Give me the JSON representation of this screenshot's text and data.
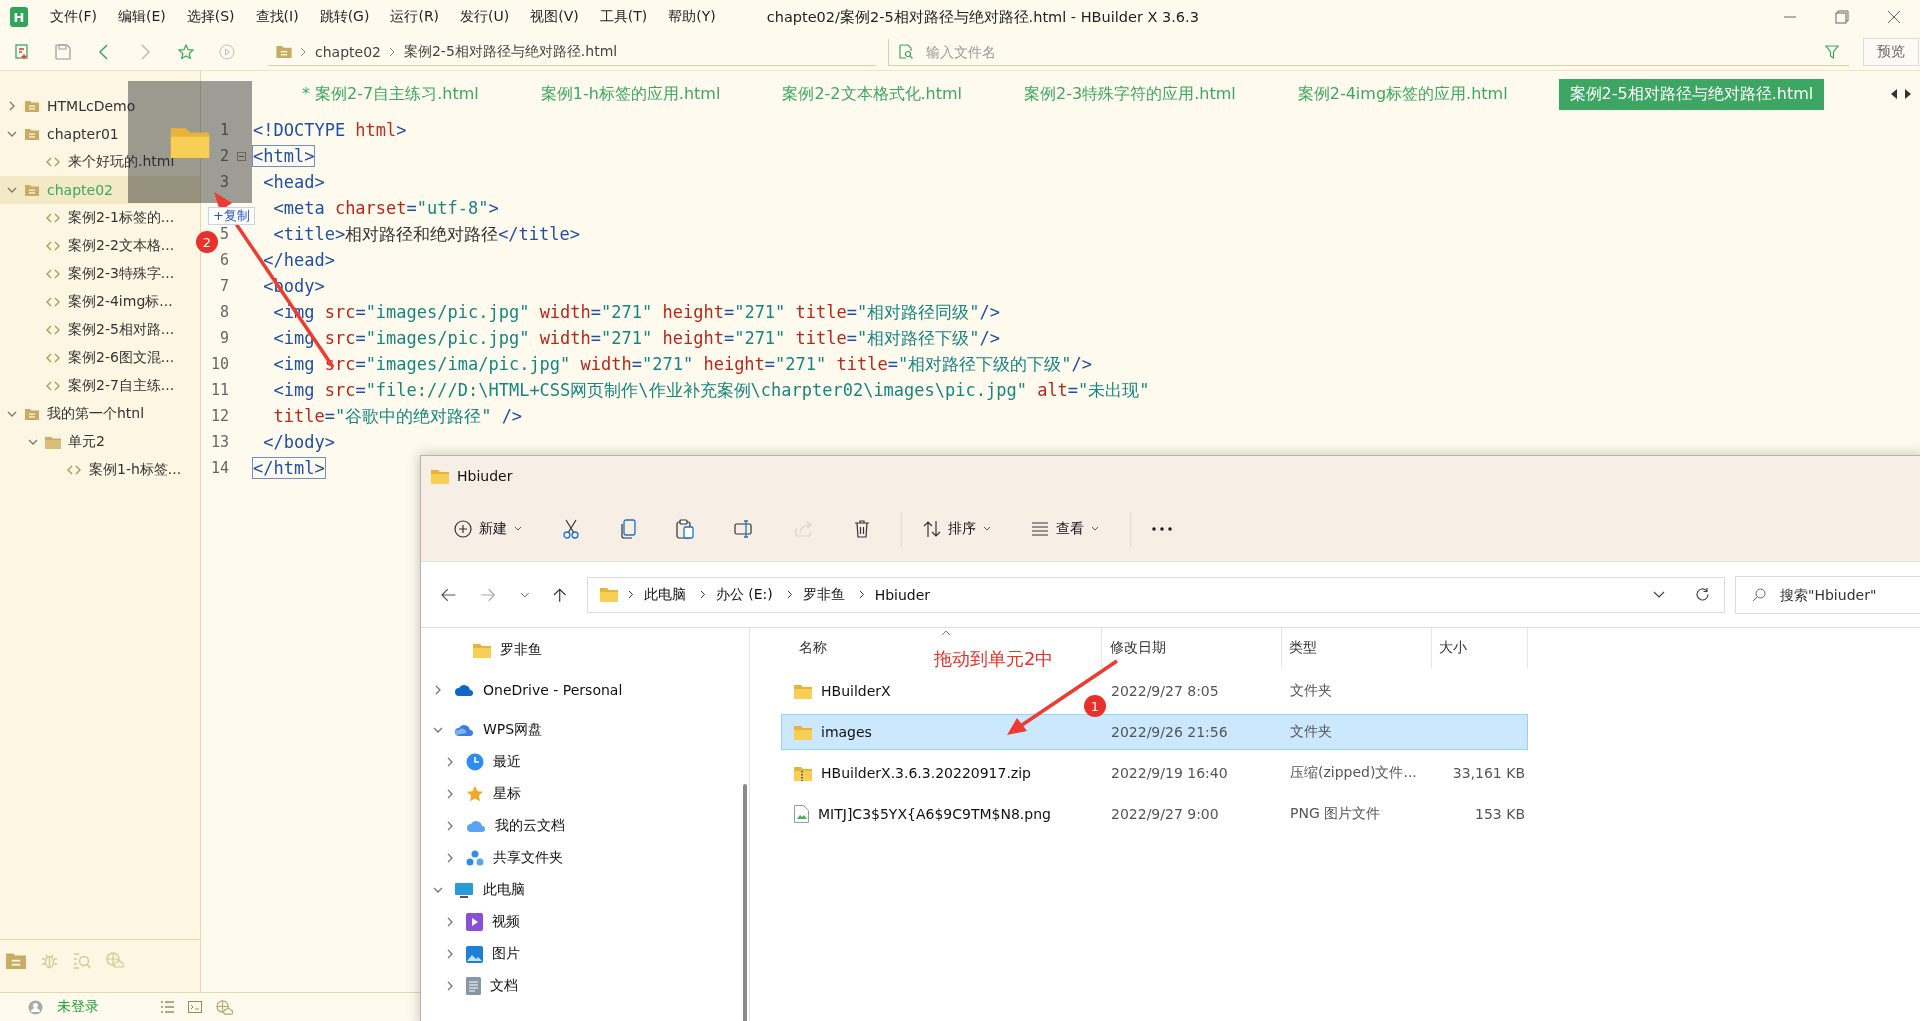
{
  "title_bar": {
    "logo": "H",
    "menus": [
      "文件(F)",
      "编辑(E)",
      "选择(S)",
      "查找(I)",
      "跳转(G)",
      "运行(R)",
      "发行(U)",
      "视图(V)",
      "工具(T)",
      "帮助(Y)"
    ],
    "title": "chapte02/案例2-5相对路径与绝对路径.html - HBuilder X 3.6.3"
  },
  "toolbar": {
    "breadcrumb": [
      "chapte02",
      "案例2-5相对路径与绝对路径.html"
    ],
    "search": {
      "placeholder": "输入文件名"
    },
    "preview_button": "预览"
  },
  "tabs": [
    {
      "label": "* 案例2-7自主练习.html",
      "selected": false
    },
    {
      "label": "案例1-h标签的应用.html",
      "selected": false
    },
    {
      "label": "案例2-2文本格式化.html",
      "selected": false
    },
    {
      "label": "案例2-3特殊字符的应用.html",
      "selected": false
    },
    {
      "label": "案例2-4img标签的应用.html",
      "selected": false
    },
    {
      "label": "案例2-5相对路径与绝对路径.html",
      "selected": true
    }
  ],
  "project_tree": [
    {
      "label": "HTMLcDemo",
      "kind": "project",
      "expanded": false,
      "selected": false
    },
    {
      "label": "chapter01",
      "kind": "project",
      "expanded": true,
      "selected": false,
      "children": [
        {
          "label": "来个好玩的.html",
          "kind": "file",
          "selected": false
        }
      ]
    },
    {
      "label": "chapte02",
      "kind": "project",
      "expanded": true,
      "selected": true,
      "children": [
        {
          "label": "案例2-1标签的...",
          "kind": "file",
          "selected": false
        },
        {
          "label": "案例2-2文本格...",
          "kind": "file",
          "selected": false
        },
        {
          "label": "案例2-3特殊字...",
          "kind": "file",
          "selected": false
        },
        {
          "label": "案例2-4img标...",
          "kind": "file",
          "selected": false
        },
        {
          "label": "案例2-5相对路...",
          "kind": "file",
          "selected": false
        },
        {
          "label": "案例2-6图文混...",
          "kind": "file",
          "selected": false
        },
        {
          "label": "案例2-7自主练...",
          "kind": "file",
          "selected": false
        }
      ]
    },
    {
      "label": "我的第一个htnl",
      "kind": "project",
      "expanded": true,
      "selected": false,
      "children": [
        {
          "label": "单元2",
          "kind": "folder",
          "expanded": true,
          "selected": false,
          "children": [
            {
              "label": "案例1-h标签...",
              "kind": "file",
              "selected": false
            }
          ]
        }
      ]
    }
  ],
  "editor": {
    "lines": [
      {
        "num": "1",
        "fold": false,
        "tokens": [
          {
            "kind": "tag",
            "text": "<!DOCTYPE "
          },
          {
            "kind": "kw",
            "text": "html"
          },
          {
            "kind": "tag",
            "text": ">"
          }
        ]
      },
      {
        "num": "2",
        "fold": true,
        "tokens": [
          {
            "kind": "match",
            "text": "<html>"
          }
        ]
      },
      {
        "num": "3",
        "fold": false,
        "tokens": [
          {
            "kind": "tag",
            "text": " <head>"
          }
        ]
      },
      {
        "fold": false,
        "tokens": [
          {
            "kind": "tag",
            "text": "  <meta "
          },
          {
            "kind": "attr",
            "text": "charset"
          },
          {
            "kind": "tag",
            "text": "="
          },
          {
            "kind": "str",
            "text": "\"utf-8\""
          },
          {
            "kind": "tag",
            "text": ">"
          }
        ]
      },
      {
        "num": "5",
        "fold": false,
        "tokens": [
          {
            "kind": "tag",
            "text": "  <title>"
          },
          {
            "kind": "text",
            "text": "相对路径和绝对路径"
          },
          {
            "kind": "tag",
            "text": "</title>"
          }
        ]
      },
      {
        "num": "6",
        "fold": false,
        "tokens": [
          {
            "kind": "tag",
            "text": " </head>"
          }
        ]
      },
      {
        "num": "7",
        "fold": false,
        "tokens": [
          {
            "kind": "tag",
            "text": " <body>"
          }
        ]
      },
      {
        "num": "8",
        "fold": false,
        "tokens": [
          {
            "kind": "tag",
            "text": "  <img "
          },
          {
            "kind": "attr",
            "text": "src"
          },
          {
            "kind": "tag",
            "text": "="
          },
          {
            "kind": "str",
            "text": "\"images/pic.jpg\""
          },
          {
            "kind": "attr",
            "text": " width"
          },
          {
            "kind": "tag",
            "text": "="
          },
          {
            "kind": "str",
            "text": "\"271\""
          },
          {
            "kind": "attr",
            "text": " height"
          },
          {
            "kind": "tag",
            "text": "="
          },
          {
            "kind": "str",
            "text": "\"271\""
          },
          {
            "kind": "attr",
            "text": " title"
          },
          {
            "kind": "tag",
            "text": "="
          },
          {
            "kind": "str",
            "text": "\"相对路径同级\""
          },
          {
            "kind": "tag",
            "text": "/>"
          }
        ]
      },
      {
        "num": "9",
        "fold": false,
        "tokens": [
          {
            "kind": "tag",
            "text": "  <img "
          },
          {
            "kind": "attr",
            "text": "src"
          },
          {
            "kind": "tag",
            "text": "="
          },
          {
            "kind": "str",
            "text": "\"images/pic.jpg\""
          },
          {
            "kind": "attr",
            "text": " width"
          },
          {
            "kind": "tag",
            "text": "="
          },
          {
            "kind": "str",
            "text": "\"271\""
          },
          {
            "kind": "attr",
            "text": " height"
          },
          {
            "kind": "tag",
            "text": "="
          },
          {
            "kind": "str",
            "text": "\"271\""
          },
          {
            "kind": "attr",
            "text": " title"
          },
          {
            "kind": "tag",
            "text": "="
          },
          {
            "kind": "str",
            "text": "\"相对路径下级\""
          },
          {
            "kind": "tag",
            "text": "/>"
          }
        ]
      },
      {
        "num": "10",
        "fold": false,
        "tokens": [
          {
            "kind": "tag",
            "text": "  <img "
          },
          {
            "kind": "attr",
            "text": "src"
          },
          {
            "kind": "tag",
            "text": "="
          },
          {
            "kind": "str",
            "text": "\"images/ima/pic.jpg\""
          },
          {
            "kind": "attr",
            "text": " width"
          },
          {
            "kind": "tag",
            "text": "="
          },
          {
            "kind": "str",
            "text": "\"271\""
          },
          {
            "kind": "attr",
            "text": " height"
          },
          {
            "kind": "tag",
            "text": "="
          },
          {
            "kind": "str",
            "text": "\"271\""
          },
          {
            "kind": "attr",
            "text": " title"
          },
          {
            "kind": "tag",
            "text": "="
          },
          {
            "kind": "str",
            "text": "\"相对路径下级的下级\""
          },
          {
            "kind": "tag",
            "text": "/>"
          }
        ]
      },
      {
        "num": "11",
        "fold": false,
        "tokens": [
          {
            "kind": "tag",
            "text": "  <img "
          },
          {
            "kind": "attr",
            "text": "src"
          },
          {
            "kind": "tag",
            "text": "="
          },
          {
            "kind": "str",
            "text": "\"file:///D:\\HTML+CSS网页制作\\作业补充案例\\charpter02\\images\\pic.jpg\""
          },
          {
            "kind": "attr",
            "text": " alt"
          },
          {
            "kind": "tag",
            "text": "="
          },
          {
            "kind": "str",
            "text": "\"未出现\""
          }
        ]
      },
      {
        "num": "12",
        "fold": false,
        "tokens": [
          {
            "kind": "attr",
            "text": "  title"
          },
          {
            "kind": "tag",
            "text": "="
          },
          {
            "kind": "str",
            "text": "\"谷歌中的绝对路径\""
          },
          {
            "kind": "tag",
            "text": " />"
          }
        ]
      },
      {
        "num": "13",
        "fold": false,
        "tokens": [
          {
            "kind": "tag",
            "text": " </body>"
          }
        ]
      },
      {
        "num": "14",
        "fold": false,
        "tokens": [
          {
            "kind": "match",
            "text": "</html>"
          }
        ]
      }
    ]
  },
  "drag": {
    "badge": "+复制"
  },
  "status_bar": {
    "user": "未登录"
  },
  "explorer": {
    "title": "Hbiuder",
    "commands": [
      {
        "kind": "new",
        "label": "新建",
        "dropdown": true,
        "disabled": false
      },
      {
        "kind": "cut",
        "dropdown": false,
        "disabled": false
      },
      {
        "kind": "copy",
        "dropdown": false,
        "disabled": false
      },
      {
        "kind": "paste",
        "dropdown": false,
        "disabled": false
      },
      {
        "kind": "rename",
        "dropdown": false,
        "disabled": false
      },
      {
        "kind": "share",
        "dropdown": false,
        "disabled": true
      },
      {
        "kind": "delete",
        "dropdown": false,
        "disabled": false
      },
      {
        "kind": "sort",
        "label": "排序",
        "dropdown": true,
        "disabled": false
      },
      {
        "kind": "view",
        "label": "查看",
        "dropdown": true,
        "disabled": false
      },
      {
        "kind": "more",
        "dropdown": false,
        "disabled": false
      }
    ],
    "address": [
      "此电脑",
      "办公 (E:)",
      "罗非鱼",
      "Hbiuder"
    ],
    "search": {
      "placeholder": "搜索\"Hbiuder\""
    },
    "nav": [
      {
        "label": "罗非鱼",
        "kind": "folder"
      },
      {
        "label": "OneDrive - Personal",
        "kind": "onedrive",
        "expanded": false
      },
      {
        "label": "WPS网盘",
        "kind": "wps",
        "expanded": true,
        "children": [
          {
            "label": "最近",
            "kind": "recent",
            "expanded": false
          },
          {
            "label": "星标",
            "kind": "star",
            "expanded": false
          },
          {
            "label": "我的云文档",
            "kind": "cloud",
            "expanded": false
          },
          {
            "label": "共享文件夹",
            "kind": "shared",
            "expanded": false
          }
        ]
      },
      {
        "label": "此电脑",
        "kind": "pc",
        "expanded": true,
        "children": [
          {
            "label": "视频",
            "kind": "video",
            "expanded": false
          },
          {
            "label": "图片",
            "kind": "pictures",
            "expanded": false
          },
          {
            "label": "文档",
            "kind": "docs",
            "expanded": false
          }
        ]
      }
    ],
    "columns": [
      "名称",
      "修改日期",
      "类型",
      "大小"
    ],
    "rows": [
      {
        "kind": "folder",
        "name": "HBuilderX",
        "date": "2022/9/27 8:05",
        "type": "文件夹",
        "selected": false
      },
      {
        "kind": "folder",
        "name": "images",
        "date": "2022/9/26 21:56",
        "type": "文件夹",
        "selected": true
      },
      {
        "kind": "zip",
        "name": "HBuilderX.3.6.3.20220917.zip",
        "date": "2022/9/19 16:40",
        "type": "压缩(zipped)文件...",
        "size": "33,161 KB",
        "selected": false
      },
      {
        "kind": "image",
        "name": "MITJ]C3$5YX{A6$9C9TM$N8.png",
        "date": "2022/9/27 9:00",
        "type": "PNG 图片文件",
        "size": "153 KB",
        "selected": false
      }
    ]
  },
  "annotations": [
    {
      "kind": "badge",
      "label": "2"
    },
    {
      "kind": "badge",
      "label": "1"
    },
    {
      "kind": "note",
      "text": "拖动到单元2中"
    }
  ]
}
